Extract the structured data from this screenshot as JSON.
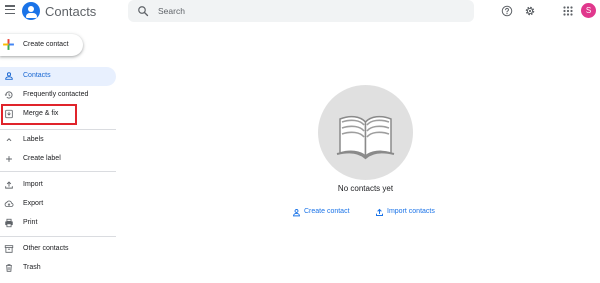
{
  "header": {
    "title": "Contacts",
    "search": {
      "placeholder": "Search",
      "value": ""
    },
    "avatar_letter": "S",
    "icons": [
      "menu-icon",
      "contacts-logo-icon",
      "search-icon",
      "help-icon",
      "settings-icon",
      "apps-grid-icon"
    ]
  },
  "sidebar": {
    "create_label": "Create contact",
    "items": [
      {
        "label": "Contacts",
        "icon": "person-icon",
        "active": true
      },
      {
        "label": "Frequently contacted",
        "icon": "history-icon"
      },
      {
        "label": "Merge & fix",
        "icon": "merge-icon",
        "highlighted": true
      },
      {
        "label": "Labels",
        "icon": "chevron-up-icon"
      },
      {
        "label": "Create label",
        "icon": "plus-icon"
      },
      {
        "label": "Import",
        "icon": "upload-icon"
      },
      {
        "label": "Export",
        "icon": "cloud-download-icon"
      },
      {
        "label": "Print",
        "icon": "print-icon"
      },
      {
        "label": "Other contacts",
        "icon": "archive-icon"
      },
      {
        "label": "Trash",
        "icon": "trash-icon"
      }
    ]
  },
  "main": {
    "empty_text": "No contacts yet",
    "create_label": "Create contact",
    "import_label": "Import contacts"
  },
  "colors": {
    "accent": "#1a73e8",
    "active_bg": "#e8f0fe",
    "avatar": "#e0388d",
    "highlight_border": "#e0242b"
  }
}
